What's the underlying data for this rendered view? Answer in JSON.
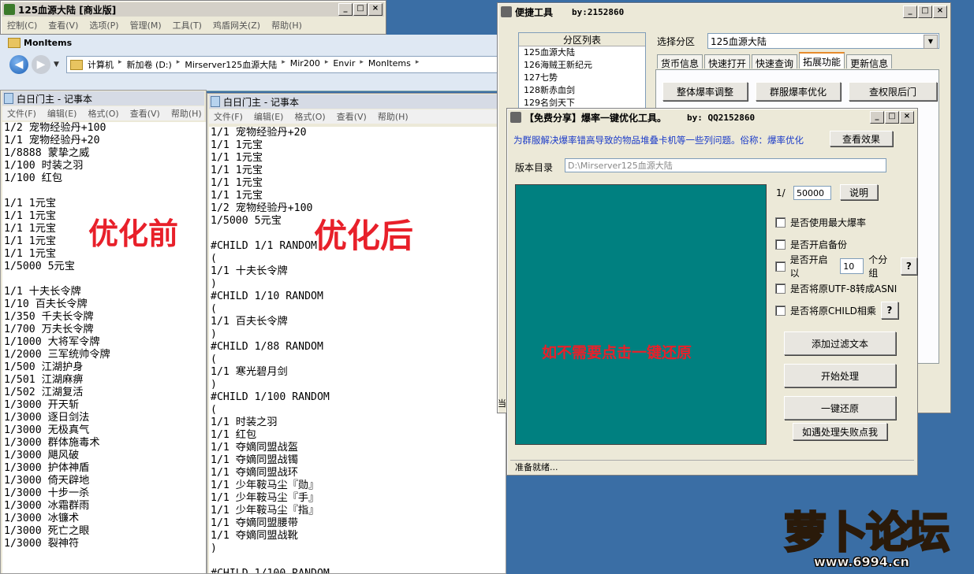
{
  "game_window": {
    "title": "125血源大陆 [商业版]",
    "menu": [
      "控制(C)",
      "查看(V)",
      "选项(P)",
      "管理(M)",
      "工具(T)",
      "鸡盾网关(Z)",
      "帮助(H)"
    ]
  },
  "explorer": {
    "title": "MonItems",
    "path": [
      "计算机",
      "新加卷 (D:)",
      "Mirserver125血源大陆",
      "Mir200",
      "Envir",
      "MonItems"
    ]
  },
  "notepad_before": {
    "title": "白日门主 - 记事本",
    "menu": [
      "文件(F)",
      "编辑(E)",
      "格式(O)",
      "查看(V)",
      "帮助(H)"
    ],
    "lines": [
      "1/2 宠物经验丹+100",
      "1/1 宠物经验丹+20",
      "1/8888 蒙挚之威",
      "1/100 时装之羽",
      "1/100 红包",
      "",
      "1/1 1元宝",
      "1/1 1元宝",
      "1/1 1元宝",
      "1/1 1元宝",
      "1/1 1元宝",
      "1/5000 5元宝",
      "",
      "1/1 十夫长令牌",
      "1/10 百夫长令牌",
      "1/350 千夫长令牌",
      "1/700 万夫长令牌",
      "1/1000 大将军令牌",
      "1/2000 三军统帅令牌",
      "1/500 江湖护身",
      "1/501 江湖麻痹",
      "1/502 江湖复活",
      "1/3000 开天斩",
      "1/3000 逐日剑法",
      "1/3000 无极真气",
      "1/3000 群体施毒术",
      "1/3000 飓风破",
      "1/3000 护体神盾",
      "1/3000 倚天辟地",
      "1/3000 十步一杀",
      "1/3000 冰霜群雨",
      "1/3000 冰镰术",
      "1/3000 死亡之眼",
      "1/3000 裂神符"
    ]
  },
  "notepad_after": {
    "title": "白日门主 - 记事本",
    "menu": [
      "文件(F)",
      "编辑(E)",
      "格式(O)",
      "查看(V)",
      "帮助(H)"
    ],
    "lines": [
      "1/1 宠物经验丹+20",
      "1/1 1元宝",
      "1/1 1元宝",
      "1/1 1元宝",
      "1/1 1元宝",
      "1/1 1元宝",
      "1/2 宠物经验丹+100",
      "1/5000 5元宝",
      "",
      "#CHILD 1/1 RANDOM",
      "(",
      "1/1 十夫长令牌",
      ")",
      "#CHILD 1/10 RANDOM",
      "(",
      "1/1 百夫长令牌",
      ")",
      "#CHILD 1/88 RANDOM",
      "(",
      "1/1 寒光碧月剑",
      ")",
      "#CHILD 1/100 RANDOM",
      "(",
      "1/1 时装之羽",
      "1/1 红包",
      "1/1 夺嫡同盟战盔",
      "1/1 夺嫡同盟战镯",
      "1/1 夺嫡同盟战环",
      "1/1 少年鞍马尘『勋』",
      "1/1 少年鞍马尘『手』",
      "1/1 少年鞍马尘『指』",
      "1/1 夺嫡同盟腰带",
      "1/1 夺嫡同盟战靴",
      ")",
      "",
      "#CHILD 1/100 RANDOM",
      "("
    ]
  },
  "labels": {
    "before": "优化前",
    "after": "优化后"
  },
  "quick_tool": {
    "title": "便捷工具",
    "author": "by:2152860",
    "partition_list_header": "分区列表",
    "partitions": [
      "125血源大陆",
      "126海贼王新纪元",
      "127七势",
      "128新赤血剑",
      "129名剑天下"
    ],
    "select_label": "选择分区",
    "select_value": "125血源大陆",
    "tabs": [
      "货币信息",
      "快速打开",
      "快速查询",
      "拓展功能",
      "更新信息"
    ],
    "active_tab": "拓展功能",
    "buttons": [
      "整体爆率调整",
      "群服爆率优化",
      "查权限后门"
    ]
  },
  "opt_tool": {
    "title": "【免费分享】爆率一键优化工具。",
    "author": "by: QQ2152860",
    "description": "为群服解决爆率错高导致的物品堆叠卡机等一些列问题。俗称：爆率优化",
    "view_effect": "查看效果",
    "version_label": "版本目录",
    "version_path": "D:\\Mirserver125血源大陆",
    "ratio_prefix": "1/",
    "ratio_value": "50000",
    "explain": "说明",
    "options": [
      {
        "label": "是否使用最大爆率"
      },
      {
        "label": "是否开启备份"
      },
      {
        "label": "是否开启以",
        "input": "10",
        "suffix": "个分组",
        "help": "?"
      },
      {
        "label": "是否将原UTF-8转成ASNI"
      },
      {
        "label": "是否将原CHILD相乘",
        "help": "?"
      }
    ],
    "actions": [
      "添加过滤文本",
      "开始处理",
      "一键还原"
    ],
    "fail_button": "如遇处理失败点我",
    "panel_text": "如不需要点击一键还原",
    "status": "准备就绪..."
  },
  "watermark": {
    "logo": "萝卜论坛",
    "url": "www.6994.cn"
  },
  "colors": {
    "panel_teal": "#008080",
    "label_red": "#e8202a",
    "title_blue": "#0a246a"
  }
}
